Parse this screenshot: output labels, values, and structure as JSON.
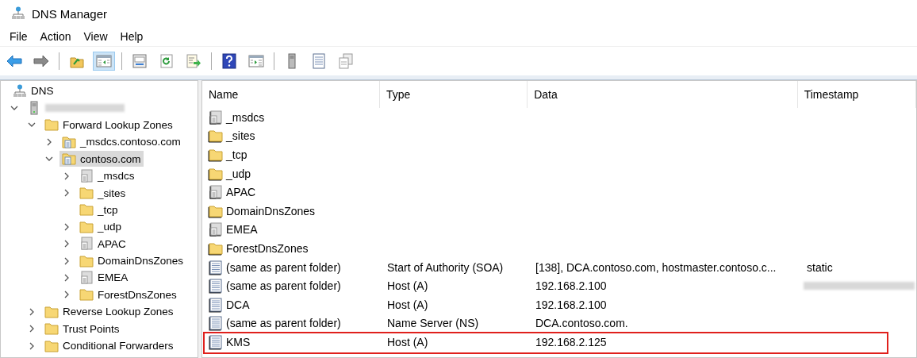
{
  "window": {
    "title": "DNS Manager"
  },
  "menu": [
    "File",
    "Action",
    "View",
    "Help"
  ],
  "toolbar": [
    [
      {
        "kind": "back",
        "pressed": false
      },
      {
        "kind": "forward",
        "pressed": false
      }
    ],
    [
      {
        "kind": "up",
        "pressed": false
      },
      {
        "kind": "tree",
        "pressed": true
      }
    ],
    [
      {
        "kind": "properties",
        "pressed": false
      },
      {
        "kind": "refresh",
        "pressed": false
      },
      {
        "kind": "export",
        "pressed": false
      }
    ],
    [
      {
        "kind": "help",
        "pressed": false
      },
      {
        "kind": "action-pane",
        "pressed": false
      }
    ],
    [
      {
        "kind": "server",
        "pressed": false
      },
      {
        "kind": "list",
        "pressed": false
      },
      {
        "kind": "copy",
        "pressed": false
      }
    ]
  ],
  "tree": [
    {
      "label": "DNS",
      "kind": "dns",
      "selected": false,
      "children": [
        {
          "kind": "server",
          "expanded": true,
          "selected": false,
          "children": [
            {
              "label": "Forward Lookup Zones",
              "kind": "folder",
              "expanded": true,
              "selected": false,
              "children": [
                {
                  "label": "_msdcs.contoso.com",
                  "kind": "zone",
                  "expanded": false,
                  "selected": false
                },
                {
                  "label": "contoso.com",
                  "kind": "zone",
                  "expanded": true,
                  "selected": true,
                  "children": [
                    {
                      "label": "_msdcs",
                      "kind": "delegation",
                      "expanded": false,
                      "selected": false
                    },
                    {
                      "label": "_sites",
                      "kind": "folder",
                      "expanded": false,
                      "selected": false
                    },
                    {
                      "label": "_tcp",
                      "kind": "folder",
                      "selected": false
                    },
                    {
                      "label": "_udp",
                      "kind": "folder",
                      "expanded": false,
                      "selected": false
                    },
                    {
                      "label": "APAC",
                      "kind": "delegation",
                      "expanded": false,
                      "selected": false
                    },
                    {
                      "label": "DomainDnsZones",
                      "kind": "folder",
                      "expanded": false,
                      "selected": false
                    },
                    {
                      "label": "EMEA",
                      "kind": "delegation",
                      "expanded": false,
                      "selected": false
                    },
                    {
                      "label": "ForestDnsZones",
                      "kind": "folder",
                      "expanded": false,
                      "selected": false
                    }
                  ]
                }
              ]
            },
            {
              "label": "Reverse Lookup Zones",
              "kind": "folder",
              "expanded": false,
              "selected": false
            },
            {
              "label": "Trust Points",
              "kind": "folder",
              "expanded": false,
              "selected": false
            },
            {
              "label": "Conditional Forwarders",
              "kind": "folder",
              "expanded": false,
              "selected": false
            }
          ]
        }
      ]
    }
  ],
  "table": {
    "columns": [
      "Name",
      "Type",
      "Data",
      "Timestamp"
    ],
    "rows": [
      {
        "kind": "delegation",
        "name": "_msdcs",
        "highlighted": false,
        "timestamp_blurred": false
      },
      {
        "kind": "folder",
        "name": "_sites",
        "highlighted": false,
        "timestamp_blurred": false
      },
      {
        "kind": "folder",
        "name": "_tcp",
        "highlighted": false,
        "timestamp_blurred": false
      },
      {
        "kind": "folder",
        "name": "_udp",
        "highlighted": false,
        "timestamp_blurred": false
      },
      {
        "kind": "delegation",
        "name": "APAC",
        "highlighted": false,
        "timestamp_blurred": false
      },
      {
        "kind": "folder",
        "name": "DomainDnsZones",
        "highlighted": false,
        "timestamp_blurred": false
      },
      {
        "kind": "delegation",
        "name": "EMEA",
        "highlighted": false,
        "timestamp_blurred": false
      },
      {
        "kind": "folder",
        "name": "ForestDnsZones",
        "highlighted": false,
        "timestamp_blurred": false
      },
      {
        "kind": "record",
        "name": "(same as parent folder)",
        "type": "Start of Authority (SOA)",
        "data": "[138], DCA.contoso.com, hostmaster.contoso.c...",
        "timestamp": "static",
        "highlighted": false,
        "timestamp_blurred": false
      },
      {
        "kind": "record",
        "name": "(same as parent folder)",
        "type": "Host (A)",
        "data": "192.168.2.100",
        "highlighted": false,
        "timestamp_blurred": true
      },
      {
        "kind": "record",
        "name": "DCA",
        "type": "Host (A)",
        "data": "192.168.2.100",
        "highlighted": false,
        "timestamp_blurred": false
      },
      {
        "kind": "record",
        "name": "(same as parent folder)",
        "type": "Name Server (NS)",
        "data": "DCA.contoso.com.",
        "highlighted": false,
        "timestamp_blurred": false
      },
      {
        "kind": "record",
        "name": "KMS",
        "type": "Host (A)",
        "data": "192.168.2.125",
        "highlighted": true,
        "timestamp_blurred": false
      }
    ]
  }
}
